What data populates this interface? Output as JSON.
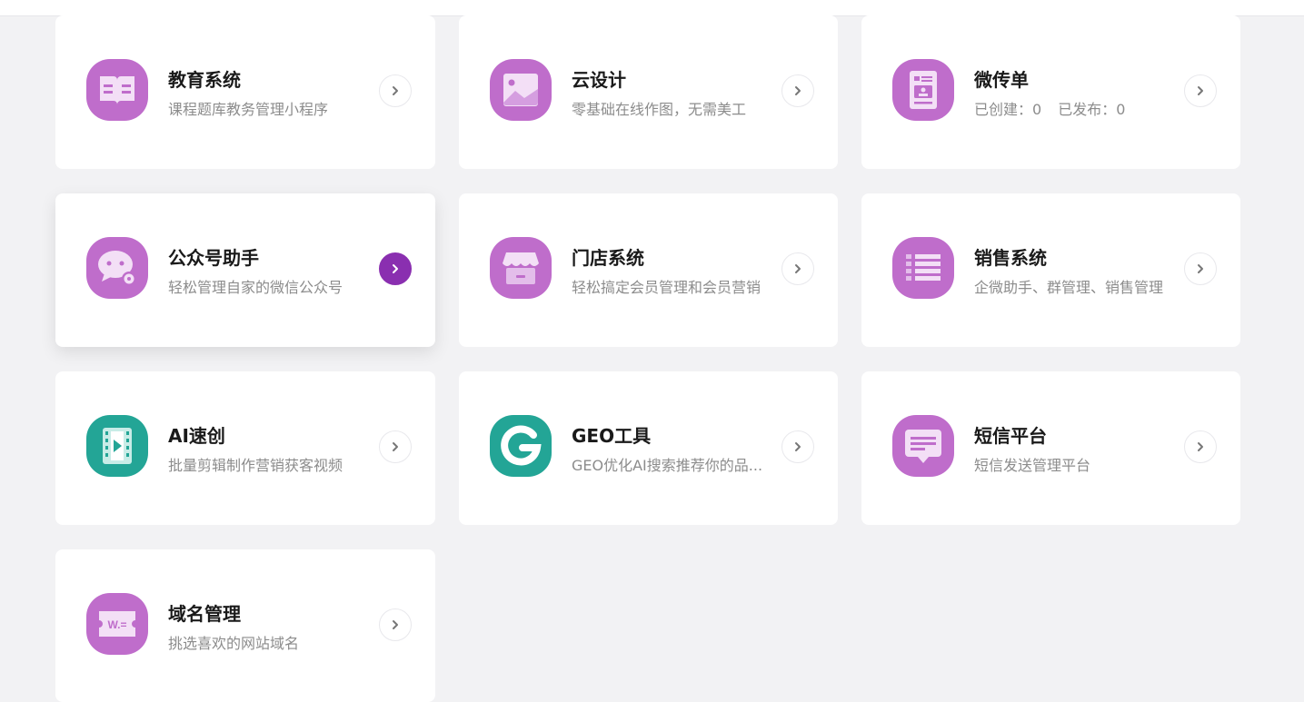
{
  "colors": {
    "purple": "#bf6dcb",
    "teal": "#23a596",
    "active_arrow": "#8a2fb0",
    "background": "#f2f2f4"
  },
  "cards": [
    {
      "title": "教育系统",
      "desc": "课程题库教务管理小程序",
      "icon": "open-book-icon"
    },
    {
      "title": "云设计",
      "desc": "零基础在线作图，无需美工",
      "icon": "image-icon"
    },
    {
      "title": "微传单",
      "stats": {
        "created_label": "已创建：",
        "created": "0",
        "published_label": "已发布：",
        "published": "0"
      },
      "icon": "flyer-icon"
    },
    {
      "title": "公众号助手",
      "desc": "轻松管理自家的微信公众号",
      "icon": "wechat-settings-icon",
      "active": true
    },
    {
      "title": "门店系统",
      "desc": "轻松搞定会员管理和会员营销",
      "icon": "store-icon"
    },
    {
      "title": "销售系统",
      "desc": "企微助手、群管理、销售管理",
      "icon": "list-icon"
    },
    {
      "title": "AI速创",
      "desc": "批量剪辑制作营销获客视频",
      "icon": "video-icon"
    },
    {
      "title": "GEO工具",
      "desc": "GEO优化AI搜索推荐你的品...",
      "icon": "geo-logo-icon"
    },
    {
      "title": "短信平台",
      "desc": "短信发送管理平台",
      "icon": "message-icon"
    },
    {
      "title": "域名管理",
      "desc": "挑选喜欢的网站域名",
      "icon": "domain-ticket-icon",
      "icon_text": "W.="
    }
  ]
}
